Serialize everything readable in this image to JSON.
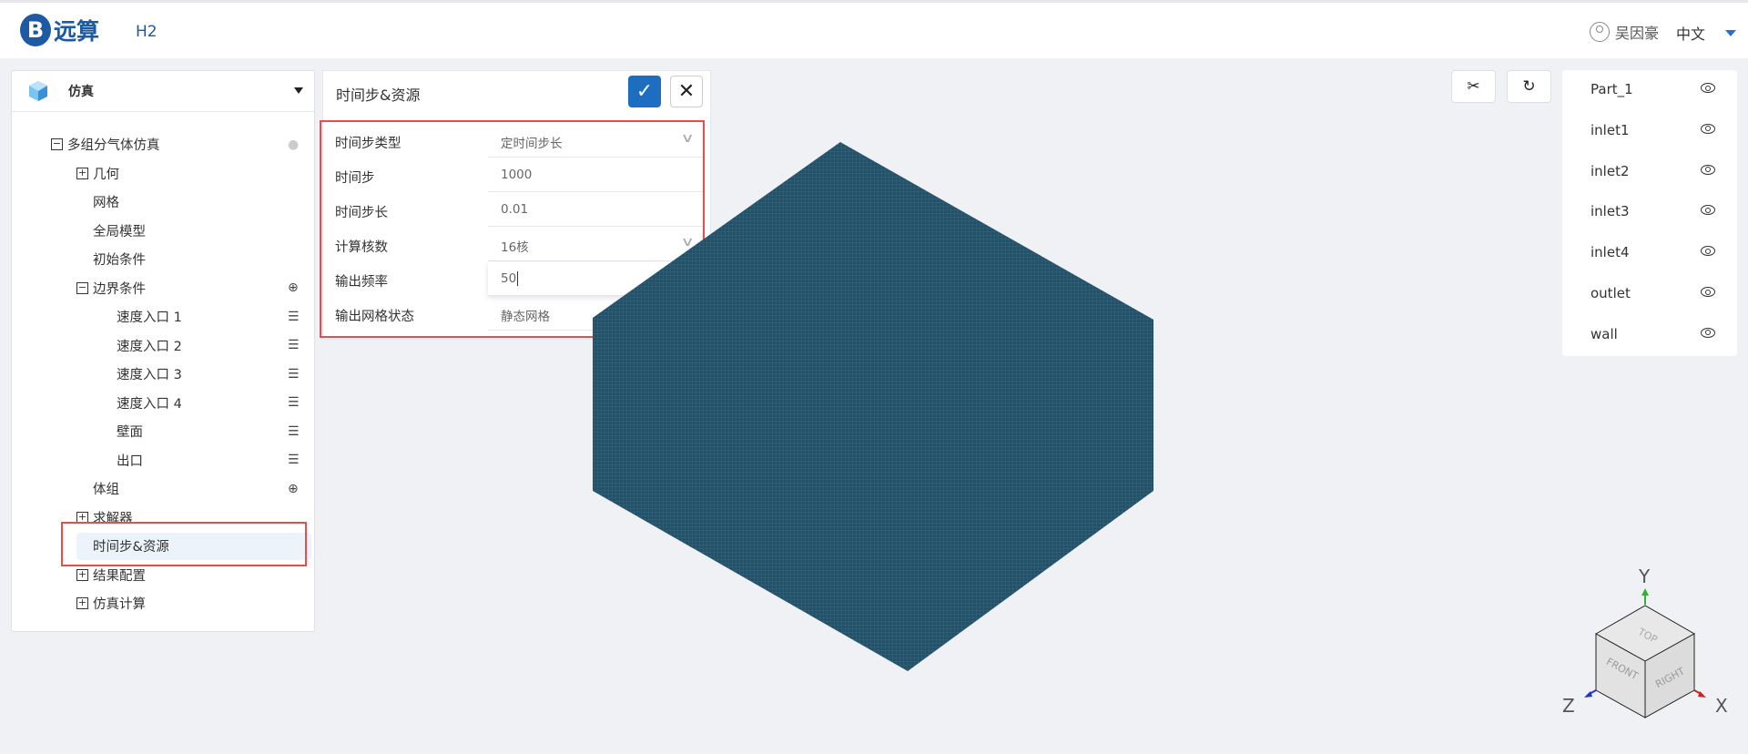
{
  "header": {
    "logo_letter": "B",
    "logo_text": "远算",
    "project": "H2",
    "user": "吴因豪",
    "language": "中文"
  },
  "left_panel": {
    "title": "仿真",
    "tree": [
      {
        "label": "多组分气体仿真",
        "expander": "minus",
        "icon": "info-icon"
      },
      {
        "label": "几何",
        "expander": "plus"
      },
      {
        "label": "网格"
      },
      {
        "label": "全局模型"
      },
      {
        "label": "初始条件"
      },
      {
        "label": "边界条件",
        "expander": "minus",
        "icon": "add-circle-icon"
      },
      {
        "label": "速度入口 1",
        "icon": "menu-icon"
      },
      {
        "label": "速度入口 2",
        "icon": "menu-icon"
      },
      {
        "label": "速度入口 3",
        "icon": "menu-icon"
      },
      {
        "label": "速度入口 4",
        "icon": "menu-icon"
      },
      {
        "label": "壁面",
        "icon": "menu-icon"
      },
      {
        "label": "出口",
        "icon": "menu-icon"
      },
      {
        "label": "体组",
        "icon": "add-circle-icon"
      },
      {
        "label": "求解器",
        "expander": "plus"
      },
      {
        "label": "时间步&资源",
        "selected": true
      },
      {
        "label": "结果配置",
        "expander": "plus"
      },
      {
        "label": "仿真计算",
        "expander": "plus"
      }
    ]
  },
  "form": {
    "title": "时间步&资源",
    "fields": [
      {
        "label": "时间步类型",
        "value": "定时间步长",
        "type": "select"
      },
      {
        "label": "时间步",
        "value": "1000",
        "type": "input"
      },
      {
        "label": "时间步长",
        "value": "0.01",
        "type": "input"
      },
      {
        "label": "计算核数",
        "value": "16核",
        "type": "select"
      },
      {
        "label": "输出频率",
        "value": "50",
        "type": "input",
        "focused": true
      },
      {
        "label": "输出网格状态",
        "value": "静态网格",
        "type": "select"
      }
    ]
  },
  "toolbar": {
    "clip_icon": "scissors-icon",
    "reset_icon": "rotate-icon"
  },
  "parts": [
    "Part_1",
    "inlet1",
    "inlet2",
    "inlet3",
    "inlet4",
    "outlet",
    "wall"
  ],
  "axes": {
    "y": "Y",
    "z": "Z",
    "x": "X",
    "faces": {
      "top": "TOP",
      "front": "FRONT",
      "right": "RIGHT"
    }
  },
  "colors": {
    "accent": "#1d6dc1",
    "highlight_box": "#f0494a",
    "mesh": "#28566e"
  }
}
